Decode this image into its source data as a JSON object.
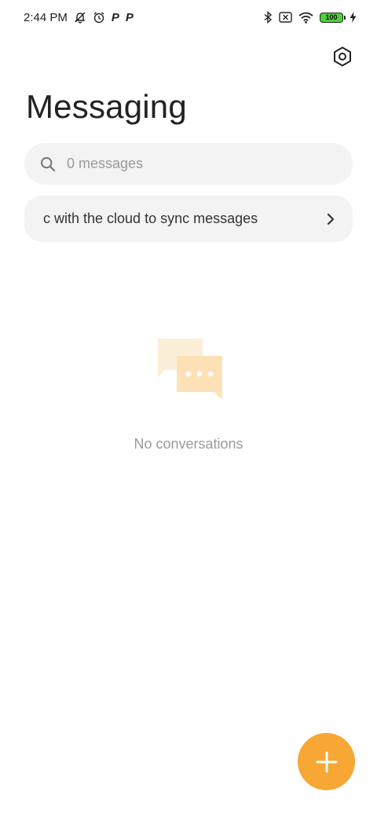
{
  "status_bar": {
    "time": "2:44 PM",
    "battery_level": "100",
    "left_icons": [
      "notifications-off-icon",
      "alarm-icon",
      "parking-app-icon",
      "parking-app-icon"
    ],
    "right_icons": [
      "bluetooth-icon",
      "no-sim-icon",
      "wifi-icon",
      "battery-icon",
      "charging-icon"
    ]
  },
  "header": {
    "title": "Messaging",
    "settings_icon": "settings-icon"
  },
  "search": {
    "placeholder": "0 messages",
    "value": "",
    "icon": "search-icon"
  },
  "sync_banner": {
    "text": "c with the cloud to sync messages",
    "icon": "chevron-right-icon"
  },
  "empty_state": {
    "icon": "conversations-icon",
    "text": "No conversations"
  },
  "fab": {
    "icon": "plus-icon"
  },
  "colors": {
    "accent": "#f7a734",
    "illustration_back": "#fdeed8",
    "illustration_front": "#fde1b6",
    "surface": "#f3f3f3"
  }
}
